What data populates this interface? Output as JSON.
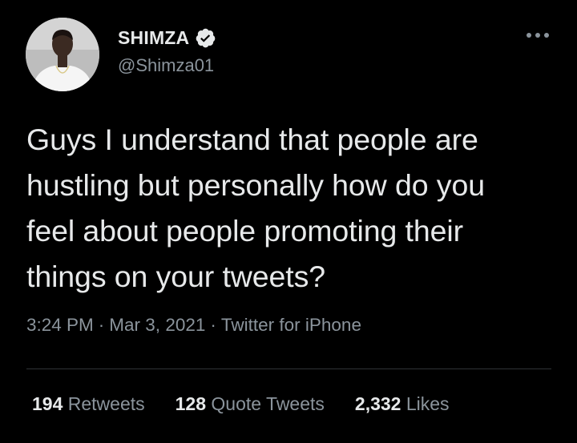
{
  "tweet": {
    "author": {
      "display_name": "SHIMZA",
      "handle": "@Shimza01",
      "avatar_icon": "profile-photo",
      "verified_icon": "verified-badge-icon"
    },
    "more_icon": "more-options-icon",
    "text": "Guys I understand that people are\nhustling but personally how do you\nfeel about people promoting their\nthings on your tweets?",
    "time": "3:24 PM",
    "date": "Mar 3, 2021",
    "source": "Twitter for iPhone",
    "separator": "·",
    "stats": {
      "retweets_count": "194",
      "retweets_label": "Retweets",
      "quotes_count": "128",
      "quotes_label": "Quote Tweets",
      "likes_count": "2,332",
      "likes_label": "Likes"
    }
  },
  "colors": {
    "background": "#000000",
    "primary_text": "#e7e9ea",
    "secondary_text": "#8b949c",
    "divider": "#2f3336"
  }
}
